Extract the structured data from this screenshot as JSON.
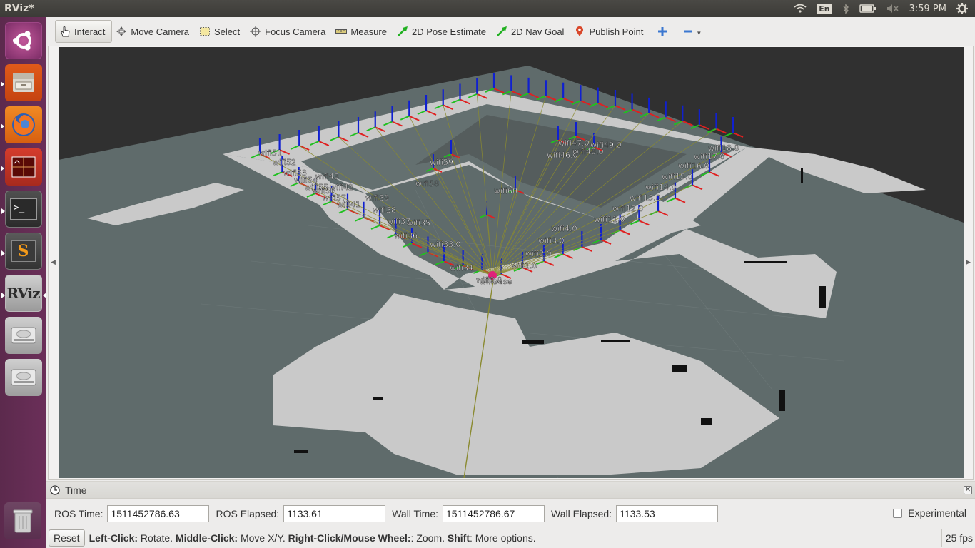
{
  "top_panel": {
    "title": "RViz*",
    "keyboard_layout": "En",
    "clock": "3:59 PM",
    "icons": [
      "wifi-icon",
      "keyboard-icon",
      "bluetooth-icon",
      "battery-icon",
      "volume-muted-icon",
      "gear-icon"
    ]
  },
  "launcher": {
    "items": [
      {
        "name": "ubuntu-dash",
        "icon": "ubuntu-logo-icon"
      },
      {
        "name": "files",
        "icon": "file-cabinet-icon"
      },
      {
        "name": "firefox",
        "icon": "firefox-icon"
      },
      {
        "name": "system-monitor",
        "icon": "monitor-icon"
      },
      {
        "name": "terminal",
        "icon": "terminal-icon",
        "glyph": ">_"
      },
      {
        "name": "sublime-text",
        "icon": "sublime-icon",
        "glyph": "S"
      },
      {
        "name": "rviz",
        "icon": "rviz-icon",
        "glyph": "RViz"
      },
      {
        "name": "disk-1",
        "icon": "disk-icon"
      },
      {
        "name": "disk-2",
        "icon": "disk-icon"
      },
      {
        "name": "trash",
        "icon": "trash-icon"
      }
    ]
  },
  "toolbar": {
    "tools": [
      {
        "label": "Interact",
        "icon": "hand-icon",
        "active": true
      },
      {
        "label": "Move Camera",
        "icon": "move-camera-icon"
      },
      {
        "label": "Select",
        "icon": "select-icon"
      },
      {
        "label": "Focus Camera",
        "icon": "crosshair-icon"
      },
      {
        "label": "Measure",
        "icon": "ruler-icon"
      },
      {
        "label": "2D Pose Estimate",
        "icon": "green-arrow-icon"
      },
      {
        "label": "2D Nav Goal",
        "icon": "green-arrow-icon"
      },
      {
        "label": "Publish Point",
        "icon": "map-pin-icon"
      }
    ],
    "add_tool": "plus-icon",
    "remove_tool": "minus-icon"
  },
  "viewport": {
    "colors": {
      "background": "#303030",
      "grid_plane": "#5f6b6b",
      "map_free": "#c8c8c8",
      "map_occupied": "#111111",
      "x_axis": "#e02020",
      "y_axis": "#20c020",
      "z_axis": "#1020d0",
      "ray": "#8a8a30",
      "origin": "#e0207a"
    },
    "labels": [
      "wifi1.0",
      "wifi2.0",
      "wifi3.0",
      "wifi4.0",
      "wifi11.0",
      "wifi12.0",
      "wifi13.0",
      "wifi14.0",
      "wifi15.0",
      "wifi16.0",
      "wifi17.0",
      "wifi18.0",
      "wifi33.0",
      "wifi34",
      "wifi35",
      "wifi36",
      "wifi37",
      "wifi38",
      "wifi39",
      "wifi41",
      "wifi42",
      "wifi43",
      "wifi46.0",
      "wifi47.0",
      "wifi48.0",
      "wifi49.0",
      "wifi51",
      "wifi52",
      "wifi53",
      "wifi54",
      "wifi55",
      "wifi56",
      "wifi57",
      "wifi58",
      "wifi59",
      "wifi60",
      "wifi0.0",
      "wifibase"
    ]
  },
  "time_panel": {
    "title": "Time",
    "fields": [
      {
        "label": "ROS Time:",
        "value": "1511452786.63"
      },
      {
        "label": "ROS Elapsed:",
        "value": "1133.61"
      },
      {
        "label": "Wall Time:",
        "value": "1511452786.67"
      },
      {
        "label": "Wall Elapsed:",
        "value": "1133.53"
      }
    ],
    "experimental_label": "Experimental",
    "experimental_checked": false
  },
  "status_bar": {
    "reset_label": "Reset",
    "hint": [
      {
        "b": "Left-Click:",
        "t": " Rotate. "
      },
      {
        "b": "Middle-Click:",
        "t": " Move X/Y. "
      },
      {
        "b": "Right-Click/Mouse Wheel:",
        "t": ": Zoom. "
      },
      {
        "b": "Shift",
        "t": ": More options."
      }
    ],
    "fps": "25 fps"
  }
}
